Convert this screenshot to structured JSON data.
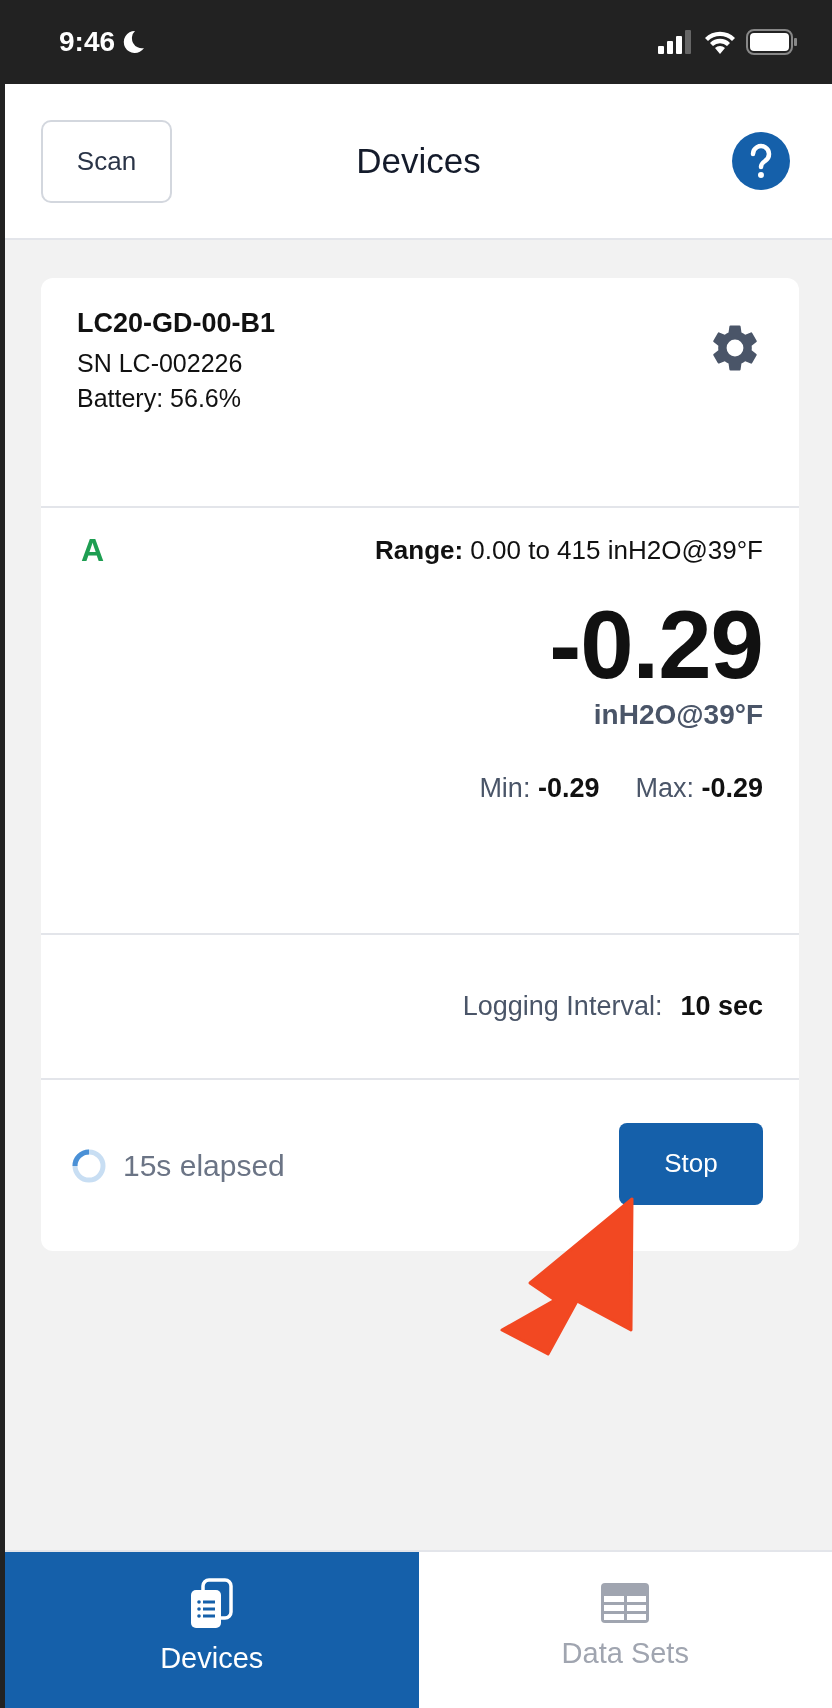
{
  "status_bar": {
    "time": "9:46"
  },
  "header": {
    "scan_button": "Scan",
    "title": "Devices"
  },
  "device": {
    "name": "LC20-GD-00-B1",
    "serial": "SN LC-002226",
    "battery": "Battery: 56.6%",
    "channel": {
      "letter": "A",
      "range": "**Range:** 0.00 to 415 inH2O@39°F",
      "value": "-0.29",
      "unit": "inH2O@39°F",
      "min": "Min: **-0.29**",
      "max": "Max: **-0.29**"
    },
    "logging": {
      "label": "Logging Interval:",
      "value": "10 sec"
    },
    "progress": {
      "text": "15s elapsed"
    },
    "stop_button": "Stop"
  },
  "tabs": [
    {
      "kind": "devices",
      "label": "Devices",
      "selected": true
    },
    {
      "kind": "datasets",
      "label": "Data Sets",
      "selected": false
    }
  ]
}
